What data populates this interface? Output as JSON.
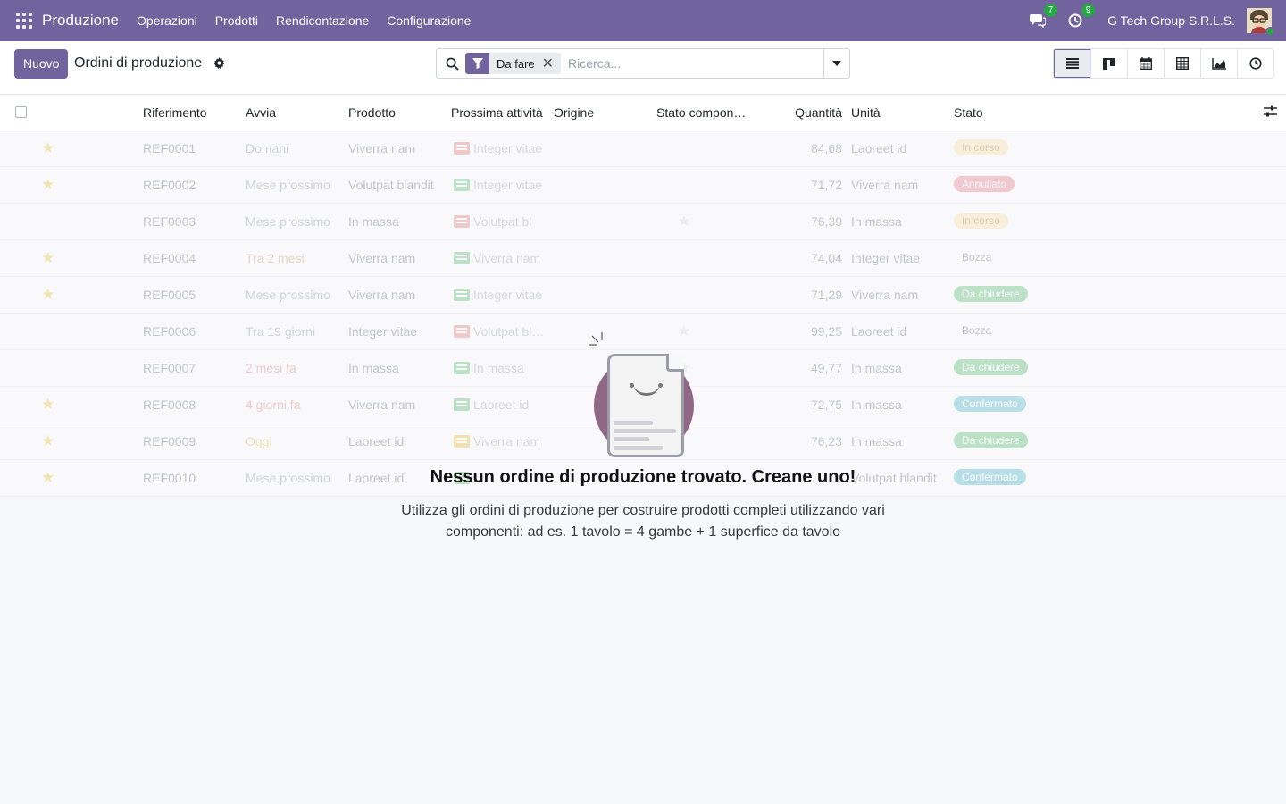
{
  "navbar": {
    "brand": "Produzione",
    "menu": [
      "Operazioni",
      "Prodotti",
      "Rendicontazione",
      "Configurazione"
    ],
    "messages_count": "7",
    "activities_count": "9",
    "company": "G Tech Group S.R.L.S."
  },
  "control": {
    "new_label": "Nuovo",
    "title": "Ordini di produzione",
    "search": {
      "facet": "Da fare",
      "placeholder": "Ricerca..."
    }
  },
  "table": {
    "headers": {
      "riferimento": "Riferimento",
      "avvia": "Avvia",
      "prodotto": "Prodotto",
      "prossima": "Prossima attività",
      "origine": "Origine",
      "stato_comp": "Stato compon…",
      "quantita": "Quantità",
      "unita": "Unità",
      "stato": "Stato"
    },
    "rows": [
      {
        "ref": "REF0001",
        "avvia": "Domani",
        "avvia_color": "#6c757d",
        "prodotto": "Viverra nam",
        "attivita": "Integer vitae",
        "act_color": "#d9534f",
        "qta": "84,68",
        "unita": "Laoreet id",
        "stato": "In corso",
        "stato_bg": "#f9d891",
        "stato_fg": "#8a6d00",
        "star": true
      },
      {
        "ref": "REF0002",
        "avvia": "Mese prossimo",
        "avvia_color": "#6c757d",
        "prodotto": "Volutpat blandit",
        "attivita": "Integer vitae",
        "act_color": "#28a745",
        "qta": "71,72",
        "unita": "Viverra nam",
        "stato": "Annullato",
        "stato_bg": "#e24e5e",
        "stato_fg": "#fff",
        "star": true
      },
      {
        "ref": "REF0003",
        "avvia": "Mese prossimo",
        "avvia_color": "#6c757d",
        "prodotto": "In massa",
        "attivita": "Volutpat bl",
        "act_color": "#d9534f",
        "qta": "76,39",
        "unita": "In massa",
        "stato": "In corso",
        "stato_bg": "#f9d891",
        "stato_fg": "#8a6d00",
        "star": false
      },
      {
        "ref": "REF0004",
        "avvia": "Tra 2 mesi",
        "avvia_color": "#c77b2a",
        "prodotto": "Viverra nam",
        "attivita": "Viverra nam",
        "act_color": "#28a745",
        "qta": "74,04",
        "unita": "Integer vitae",
        "stato": "Bozza",
        "stato_bg": "#fff",
        "stato_fg": "#444",
        "star": true
      },
      {
        "ref": "REF0005",
        "avvia": "Mese prossimo",
        "avvia_color": "#6c757d",
        "prodotto": "Viverra nam",
        "attivita": "Integer vitae",
        "act_color": "#28a745",
        "qta": "71,29",
        "unita": "Viverra nam",
        "stato": "Da chiudere",
        "stato_bg": "#28a745",
        "stato_fg": "#fff",
        "star": true
      },
      {
        "ref": "REF0006",
        "avvia": "Tra 19 giorni",
        "avvia_color": "#6c757d",
        "prodotto": "Integer vitae",
        "attivita": "Volutpat bl…",
        "act_color": "#d9534f",
        "qta": "99,25",
        "unita": "Laoreet id",
        "stato": "Bozza",
        "stato_bg": "#fff",
        "stato_fg": "#444",
        "star": false
      },
      {
        "ref": "REF0007",
        "avvia": "2 mesi fa",
        "avvia_color": "#d9534f",
        "prodotto": "In massa",
        "attivita": "In massa",
        "act_color": "#28a745",
        "qta": "49,77",
        "unita": "In massa",
        "stato": "Da chiudere",
        "stato_bg": "#28a745",
        "stato_fg": "#fff",
        "star": false
      },
      {
        "ref": "REF0008",
        "avvia": "4 giorni fa",
        "avvia_color": "#d9534f",
        "prodotto": "Viverra nam",
        "attivita": "Laoreet id",
        "act_color": "#28a745",
        "qta": "72,75",
        "unita": "In massa",
        "stato": "Confermato",
        "stato_bg": "#17a2b8",
        "stato_fg": "#fff",
        "star": true
      },
      {
        "ref": "REF0009",
        "avvia": "Oggi",
        "avvia_color": "#e0a800",
        "prodotto": "Laoreet id",
        "attivita": "Viverra nam",
        "act_color": "#e0a800",
        "qta": "76,23",
        "unita": "In massa",
        "stato": "Da chiudere",
        "stato_bg": "#28a745",
        "stato_fg": "#fff",
        "star": true
      },
      {
        "ref": "REF0010",
        "avvia": "Mese prossimo",
        "avvia_color": "#6c757d",
        "prodotto": "Laoreet id",
        "attivita": "",
        "act_color": "#28a745",
        "qta": "",
        "unita": "Volutpat blandit",
        "stato": "Confermato",
        "stato_bg": "#17a2b8",
        "stato_fg": "#fff",
        "star": true
      }
    ]
  },
  "empty_state": {
    "title": "Nessun ordine di produzione trovato. Creane uno!",
    "body": "Utilizza gli ordini di produzione per costruire prodotti completi utilizzando vari componenti: ad es. 1 tavolo = 4 gambe + 1 superfice da tavolo"
  },
  "colors": {
    "brand": "#71639e",
    "success": "#28a745"
  },
  "icons": [
    "apps-grid-icon",
    "chat-icon",
    "clock-icon",
    "search-icon",
    "filter-icon",
    "close-icon",
    "caret-down-icon",
    "gear-icon",
    "list-view-icon",
    "kanban-view-icon",
    "calendar-view-icon",
    "pivot-view-icon",
    "graph-view-icon",
    "activity-view-icon",
    "optional-columns-icon",
    "star-icon"
  ]
}
